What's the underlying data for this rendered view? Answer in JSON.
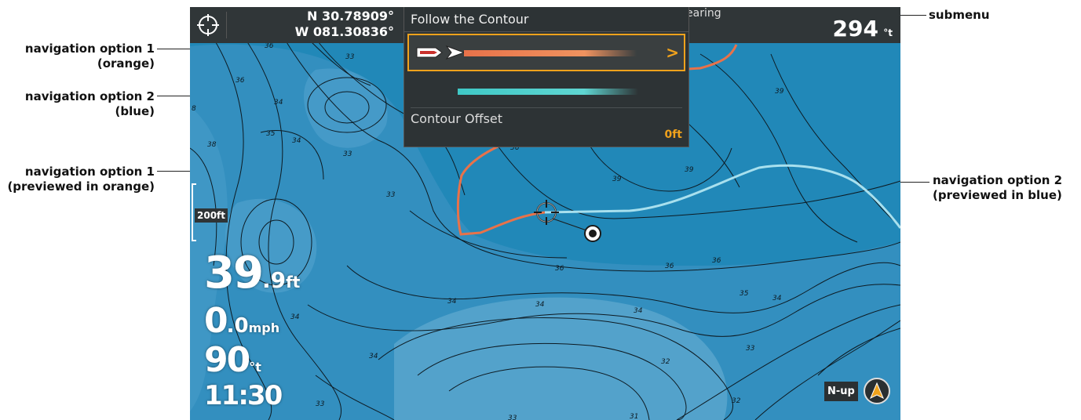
{
  "callouts": {
    "submenu": "submenu",
    "nav1_line1": "navigation option 1",
    "nav1_line2": "(orange)",
    "nav2_line1": "navigation option 2",
    "nav2_line2": "(blue)",
    "nav1_preview_line1": "navigation option 1",
    "nav1_preview_line2": "(previewed in orange)",
    "nav2_preview_line1": "navigation option 2",
    "nav2_preview_line2": "(previewed in blue)"
  },
  "header": {
    "lat": "N 30.78909°",
    "lon": "W 081.30836°",
    "bearing_label": "earing",
    "bearing_value": "294",
    "bearing_unit": "°t"
  },
  "submenu": {
    "title": "Follow the Contour",
    "option1_icon": "boat-arrow-icon",
    "option1_chevron": ">",
    "offset_label": "Contour Offset",
    "offset_value": "0ft"
  },
  "overlay": {
    "scale": "200ft",
    "depth_value": "39",
    "depth_decimal": ".9",
    "depth_unit": "ft",
    "speed_value": "0",
    "speed_decimal": ".0",
    "speed_unit": "mph",
    "heading_value": "90",
    "heading_unit": "°t",
    "time": "11:30",
    "orientation": "N-up"
  },
  "contour_labels": [
    "36",
    "33",
    "36",
    "34",
    "33",
    "38",
    "35",
    "34",
    "33",
    "36",
    "39",
    "39",
    "39",
    "36",
    "36",
    "36",
    "34",
    "34",
    "34",
    "35",
    "34",
    "33",
    "32",
    "34",
    "34",
    "32",
    "33",
    "31",
    "33",
    "8"
  ],
  "colors": {
    "water": "#1f86b5",
    "orange_route": "#e8724a",
    "blue_route": "#a8e0ee",
    "accent": "#f0a21c"
  }
}
